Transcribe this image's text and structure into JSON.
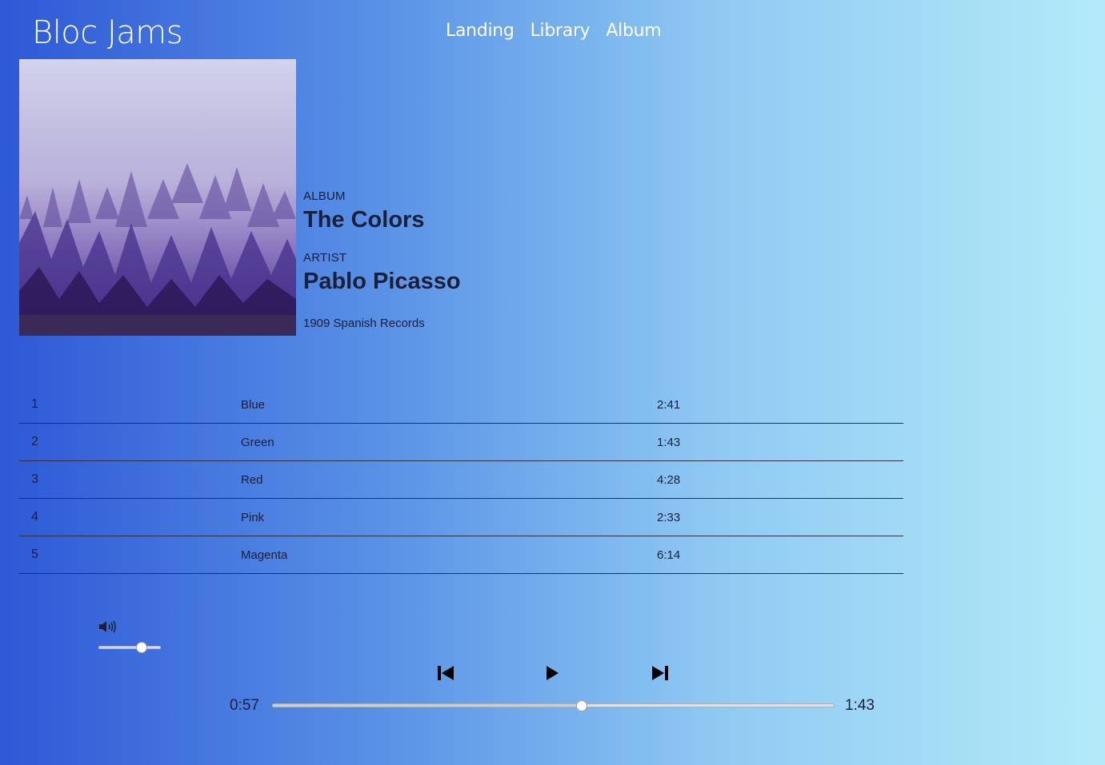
{
  "header": {
    "brand": "Bloc Jams",
    "nav": [
      "Landing",
      "Library",
      "Album"
    ]
  },
  "album": {
    "album_label": "ALBUM",
    "title": "The Colors",
    "artist_label": "ARTIST",
    "artist": "Pablo Picasso",
    "release": "1909 Spanish Records"
  },
  "songs": [
    {
      "number": "1",
      "title": "Blue",
      "duration": "2:41"
    },
    {
      "number": "2",
      "title": "Green",
      "duration": "1:43"
    },
    {
      "number": "3",
      "title": "Red",
      "duration": "4:28"
    },
    {
      "number": "4",
      "title": "Pink",
      "duration": "2:33"
    },
    {
      "number": "5",
      "title": "Magenta",
      "duration": "6:14"
    }
  ],
  "player": {
    "current_time": "0:57",
    "total_time": "1:43",
    "seek_fraction": 0.55,
    "volume_fraction": 0.7,
    "icons": {
      "volume": "volume-icon",
      "previous": "skip-previous-icon",
      "play": "play-icon",
      "next": "skip-next-icon"
    }
  },
  "colors": {
    "gradient_start": "#2d58d6",
    "gradient_end": "#b4eaf8",
    "text_dark": "#1a1f3a",
    "nav_text": "#ffffff"
  }
}
